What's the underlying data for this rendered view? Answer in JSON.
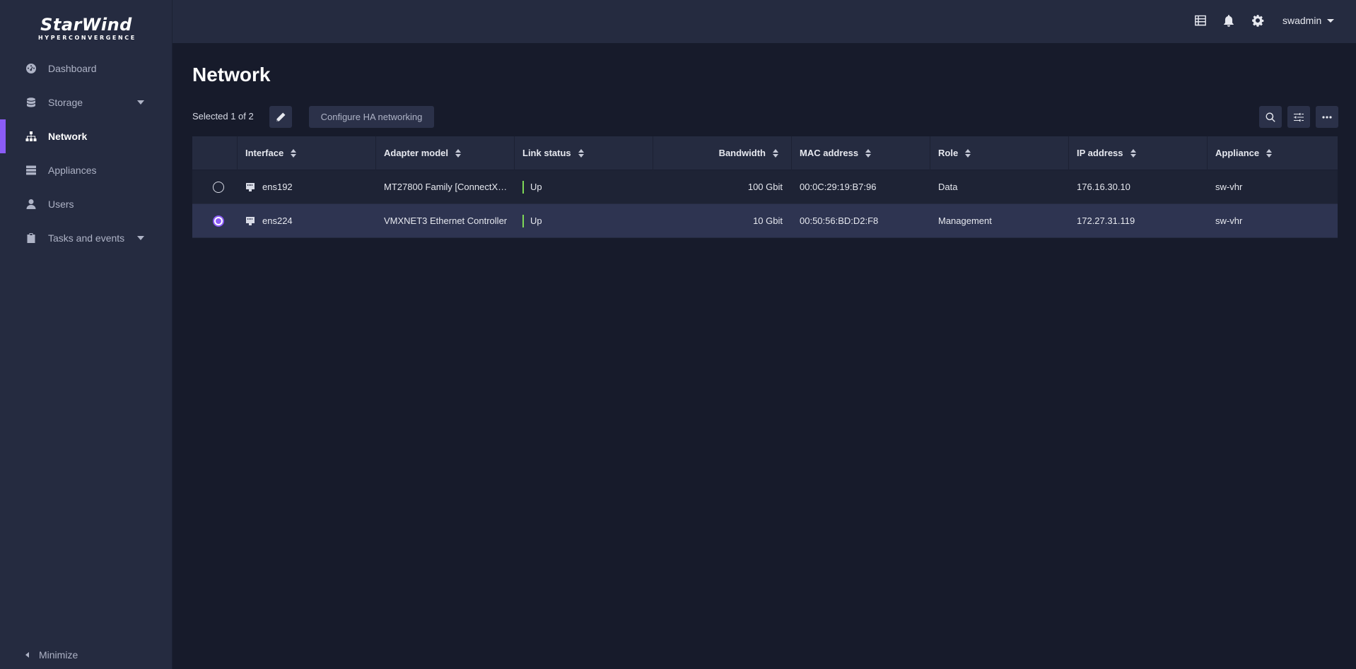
{
  "brand": {
    "name": "StarWind",
    "tagline": "HYPERCONVERGENCE"
  },
  "sidebar": {
    "items": [
      {
        "label": "Dashboard",
        "icon": "dashboard-icon"
      },
      {
        "label": "Storage",
        "icon": "storage-icon"
      },
      {
        "label": "Network",
        "icon": "network-icon"
      },
      {
        "label": "Appliances",
        "icon": "appliances-icon"
      },
      {
        "label": "Users",
        "icon": "user-icon"
      },
      {
        "label": "Tasks and events",
        "icon": "clipboard-icon"
      }
    ],
    "minimize_label": "Minimize"
  },
  "topbar": {
    "username": "swadmin"
  },
  "page": {
    "title": "Network"
  },
  "toolbar": {
    "selection_text": "Selected 1 of 2",
    "configure_label": "Configure HA networking"
  },
  "table": {
    "columns": [
      "Interface",
      "Adapter model",
      "Link status",
      "Bandwidth",
      "MAC address",
      "Role",
      "IP address",
      "Appliance"
    ],
    "rows": [
      {
        "interface": "ens192",
        "adapter": "MT27800 Family [ConnectX…",
        "link": "Up",
        "bandwidth": "100 Gbit",
        "mac": "00:0C:29:19:B7:96",
        "role": "Data",
        "ip": "176.16.30.10",
        "appliance": "sw-vhr",
        "selected": false
      },
      {
        "interface": "ens224",
        "adapter": "VMXNET3 Ethernet Controller",
        "link": "Up",
        "bandwidth": "10 Gbit",
        "mac": "00:50:56:BD:D2:F8",
        "role": "Management",
        "ip": "172.27.31.119",
        "appliance": "sw-vhr",
        "selected": true
      }
    ]
  },
  "colors": {
    "accent": "#8b5cf6",
    "status_up": "#7ed957",
    "sidebar_bg": "#252b40",
    "main_bg": "#171b2b"
  }
}
